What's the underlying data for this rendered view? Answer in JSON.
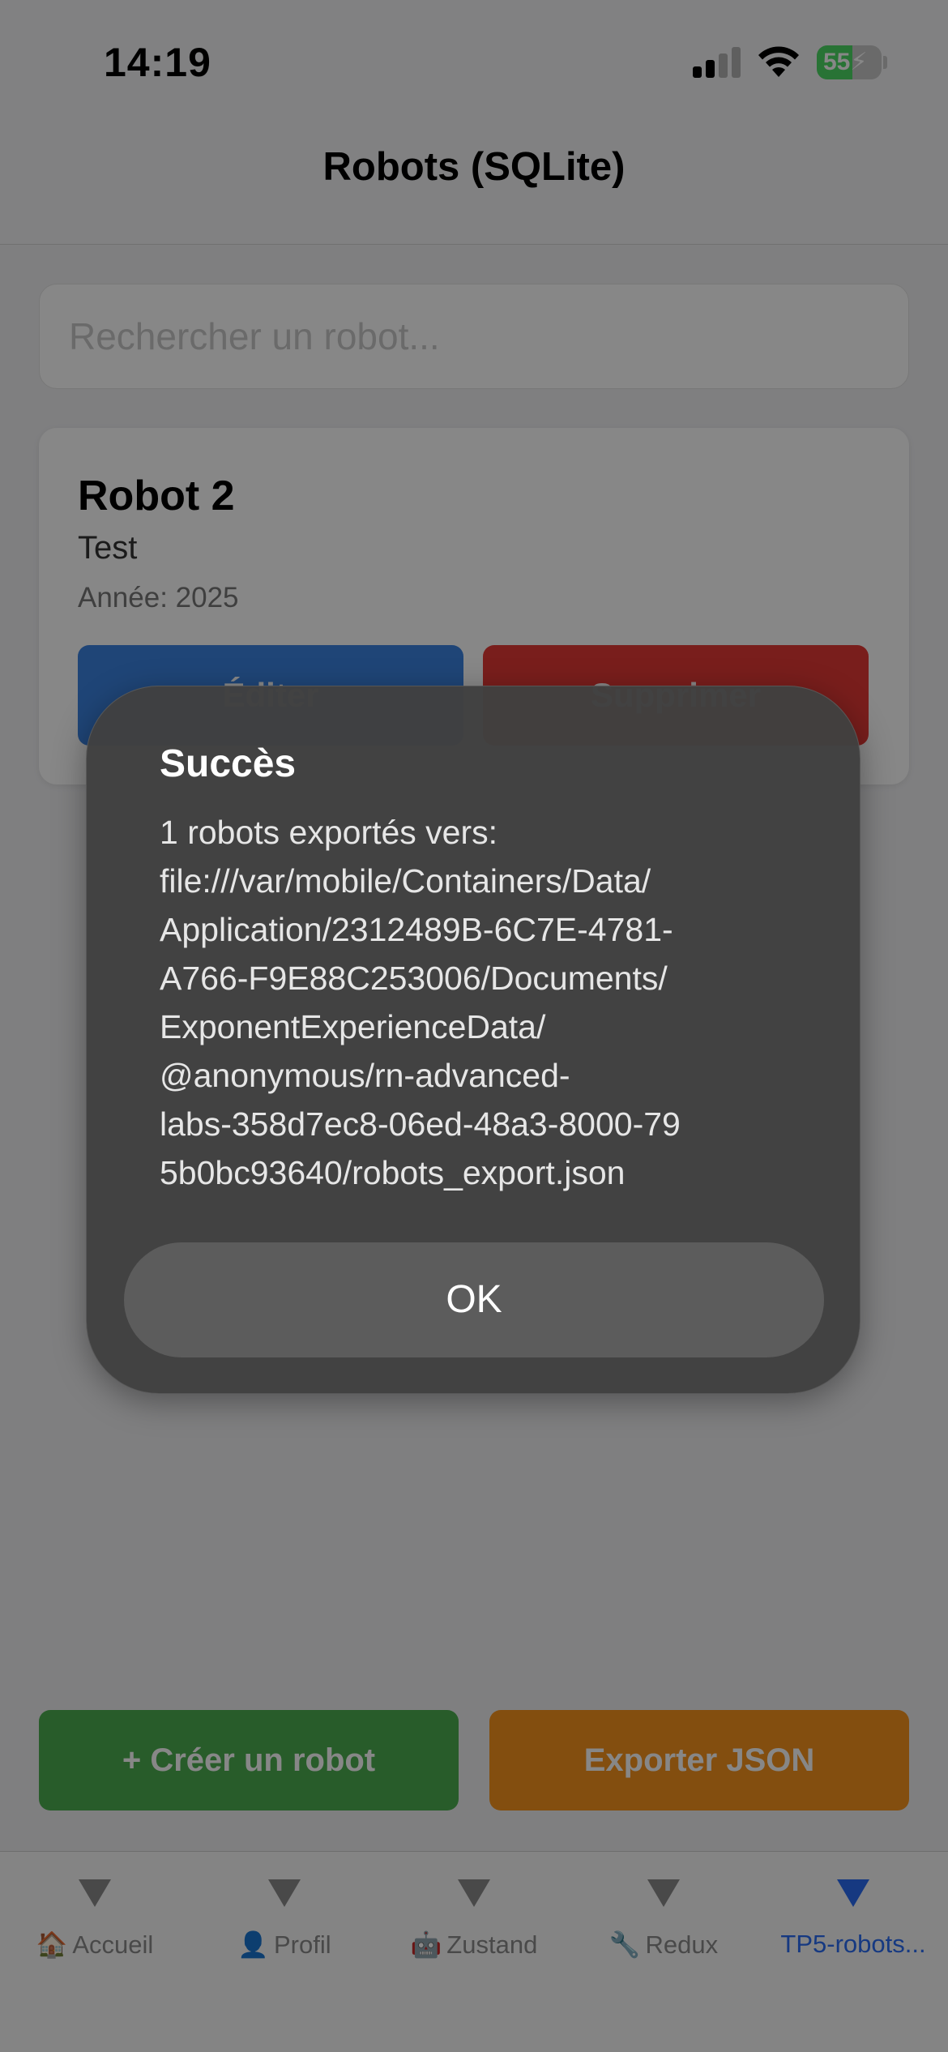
{
  "status_bar": {
    "time": "14:19",
    "battery_percent": 55,
    "battery_label": "55",
    "cellular_bars_active": 2,
    "cellular_bars_total": 4,
    "icons": [
      "cellular-signal-icon",
      "wifi-icon",
      "battery-charging-icon"
    ]
  },
  "header": {
    "title": "Robots (SQLite)"
  },
  "search": {
    "placeholder": "Rechercher un robot...",
    "value": ""
  },
  "robots": [
    {
      "name": "Robot 2",
      "description": "Test",
      "year_text": "Année: 2025",
      "edit_label": "Éditer",
      "delete_label": "Supprimer"
    }
  ],
  "actions": {
    "create_label": "+ Créer un robot",
    "export_label": "Exporter JSON"
  },
  "tabs": [
    {
      "emoji": "🏠",
      "label": "Accueil",
      "active": false
    },
    {
      "emoji": "👤",
      "label": "Profil",
      "active": false
    },
    {
      "emoji": "🤖",
      "label": "Zustand",
      "active": false
    },
    {
      "emoji": "🔧",
      "label": "Redux",
      "active": false
    },
    {
      "emoji": "",
      "label": "TP5-robots...",
      "active": true
    }
  ],
  "alert": {
    "title": "Succès",
    "message_lines": [
      "1 robots exportés vers:",
      "file:///var/mobile/Containers/Data/",
      "Application/2312489B-6C7E-4781-",
      "A766-F9E88C253006/Documents/",
      "ExponentExperienceData/",
      "@anonymous/rn-advanced-",
      "labs-358d7ec8-06ed-48a3-8000-79",
      "5b0bc93640/robots_export.json"
    ],
    "ok_label": "OK"
  },
  "colors": {
    "edit": "#3b82e0",
    "delete": "#e53a35",
    "create": "#4caf50",
    "export": "#f7931e",
    "tab_active": "#2a6df4",
    "battery": "#4cd964"
  }
}
